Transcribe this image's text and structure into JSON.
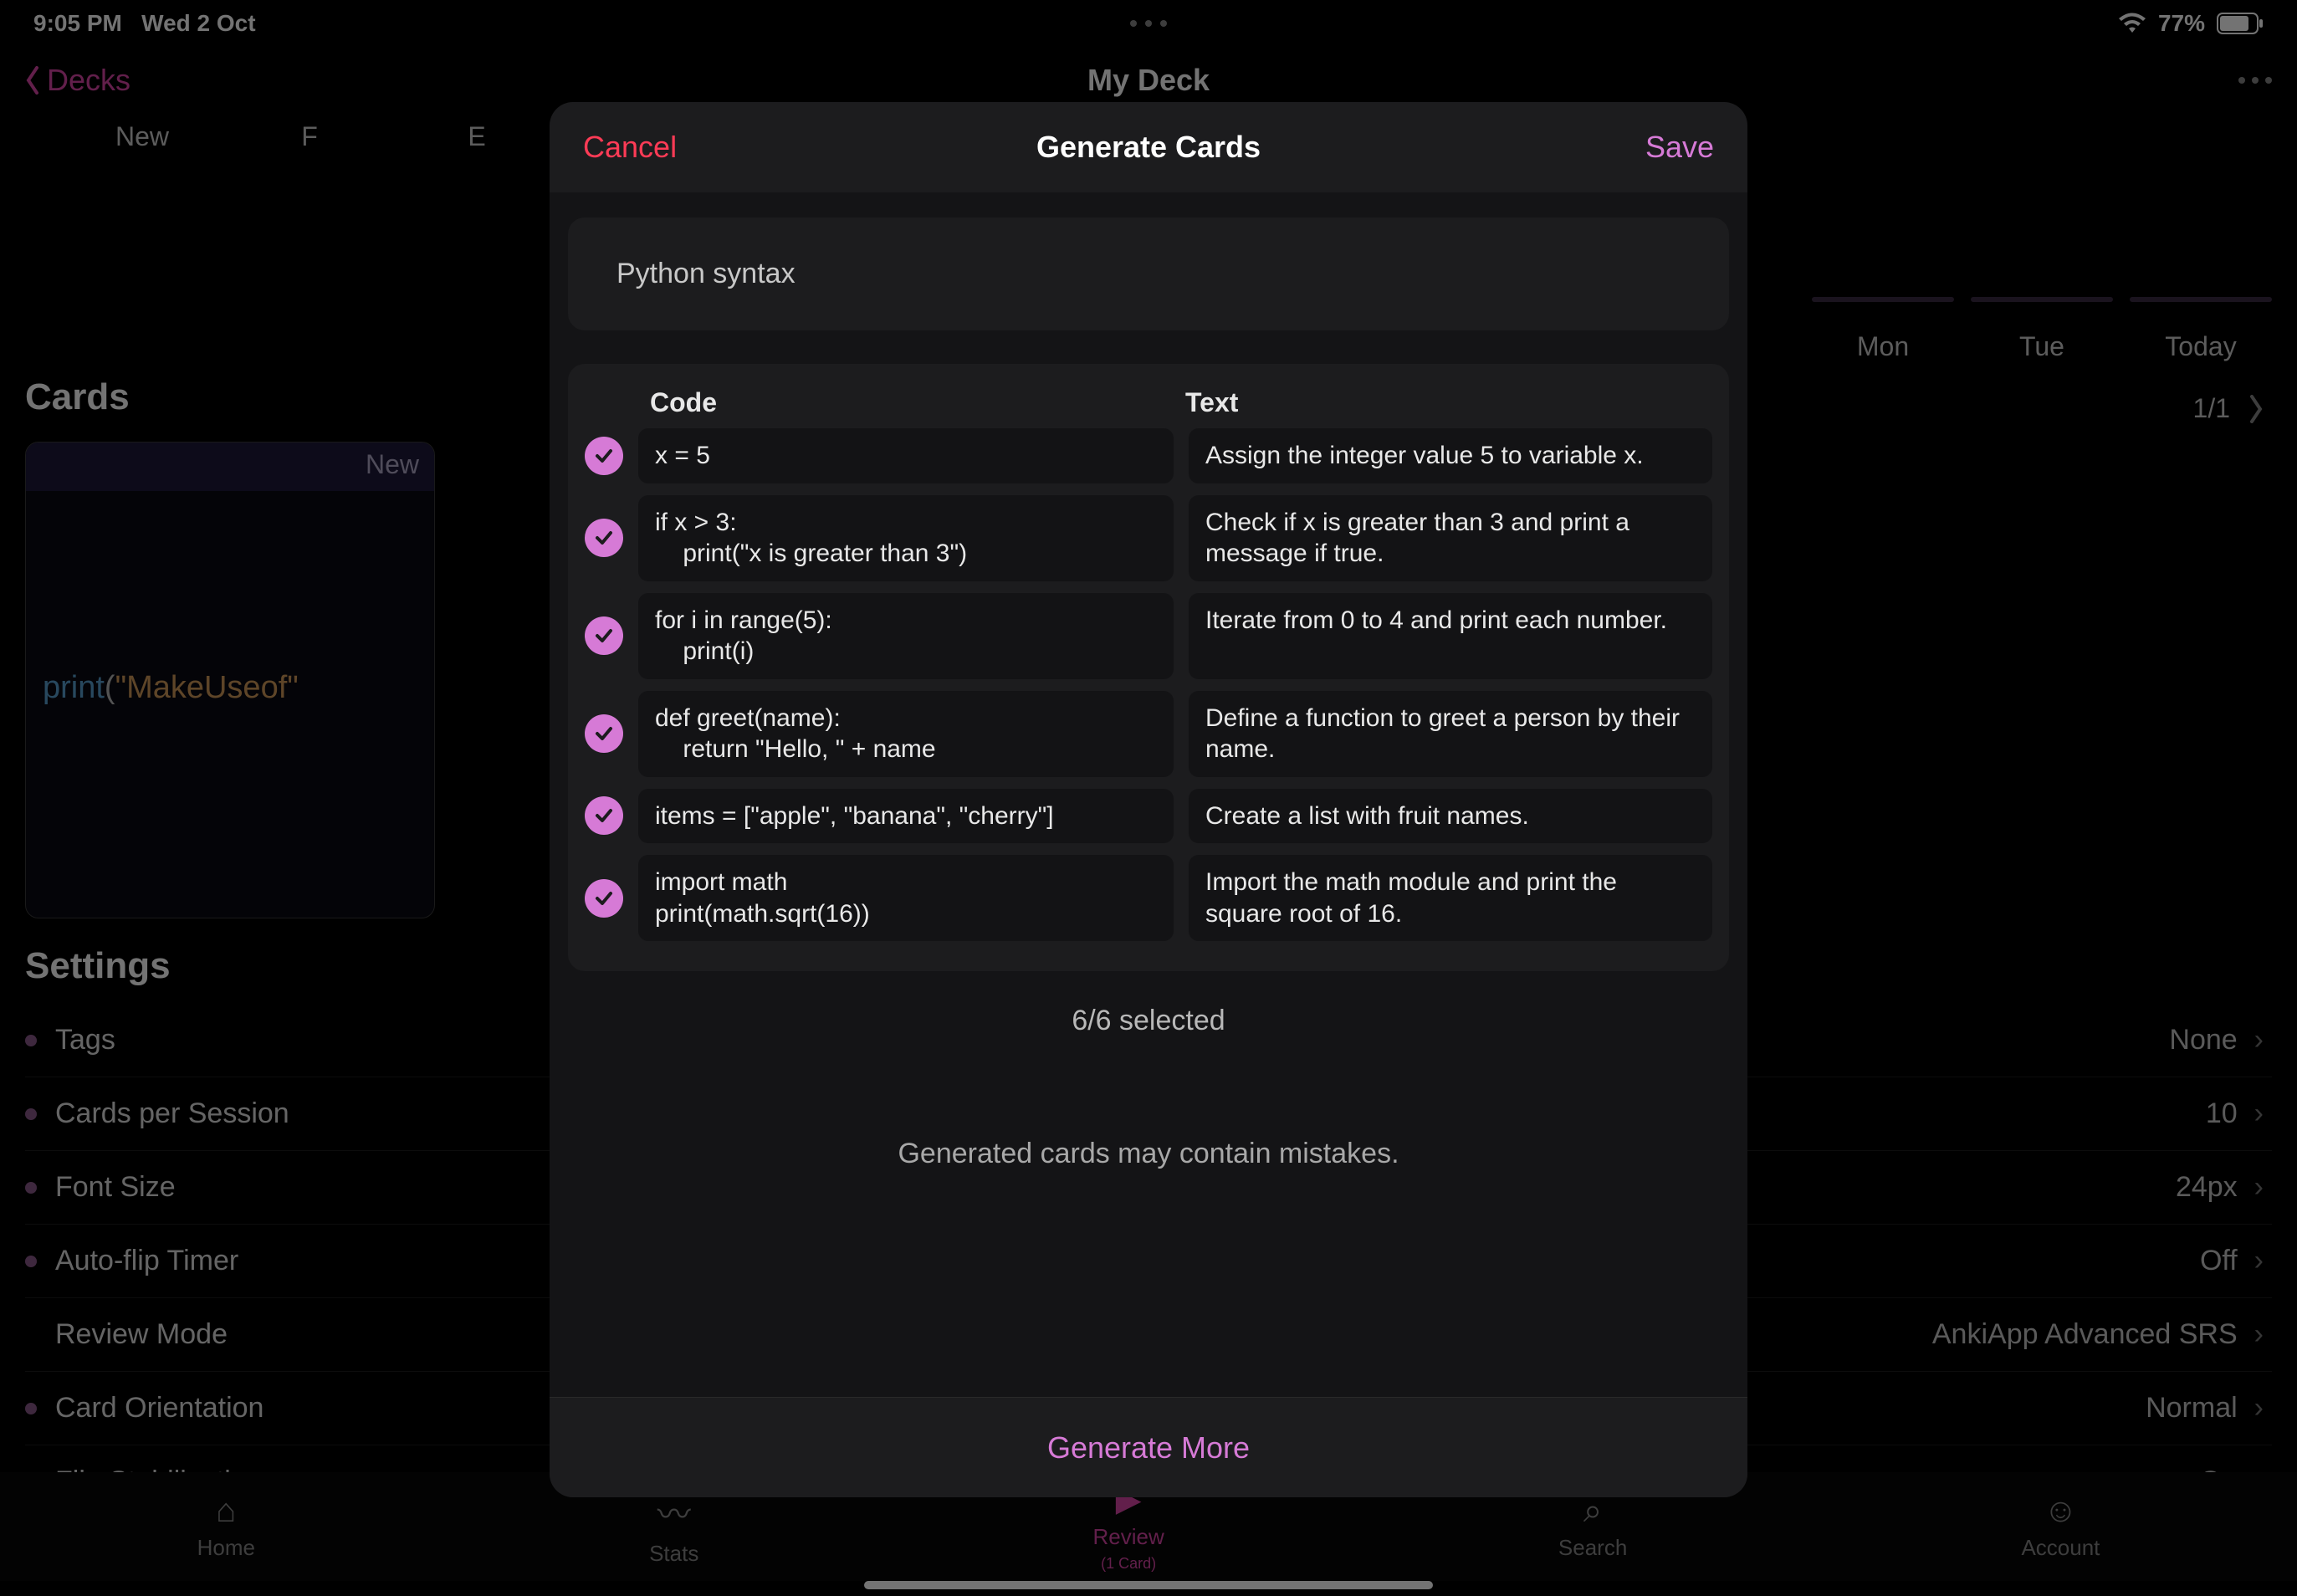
{
  "status": {
    "time": "9:05 PM",
    "date": "Wed 2 Oct",
    "battery_pct": "77%"
  },
  "header": {
    "back_label": "Decks",
    "title": "My Deck"
  },
  "bg_tabs": {
    "t0": "New",
    "t1": "F",
    "t2": "E"
  },
  "days": {
    "d0": "Mon",
    "d1": "Tue",
    "d2": "Today"
  },
  "pagination": "1/1",
  "cards_section": {
    "heading": "Cards",
    "new_badge": "New",
    "code_fn": "print",
    "code_paren_open": "(",
    "code_str": "\"MakeUseof\"",
    "code_paren_close_extra": ""
  },
  "settings": {
    "heading": "Settings",
    "rows": {
      "tags": {
        "label": "Tags",
        "value": "None"
      },
      "cps": {
        "label": "Cards per Session",
        "value": "10"
      },
      "fontsize": {
        "label": "Font Size",
        "value": "24px"
      },
      "autoflip": {
        "label": "Auto-flip Timer",
        "value": "Off"
      },
      "review": {
        "label": "Review Mode",
        "value": "AnkiApp Advanced SRS"
      },
      "orient": {
        "label": "Card Orientation",
        "value": "Normal"
      },
      "flipstab": {
        "label": "Flip Stabilization",
        "value": "On"
      }
    }
  },
  "tabbar": {
    "home": "Home",
    "stats": "Stats",
    "review": "Review",
    "review_sub": "(1 Card)",
    "search": "Search",
    "account": "Account"
  },
  "modal": {
    "cancel": "Cancel",
    "title": "Generate Cards",
    "save": "Save",
    "topic": "Python syntax",
    "col_code": "Code",
    "col_text": "Text",
    "rows": [
      {
        "code": "x = 5",
        "text": "Assign the integer value 5 to variable x."
      },
      {
        "code": "if x > 3:\n    print(\"x is greater than 3\")",
        "text": "Check if x is greater than 3 and print a message if true."
      },
      {
        "code": "for i in range(5):\n    print(i)",
        "text": "Iterate from 0 to 4 and print each number."
      },
      {
        "code": "def greet(name):\n    return \"Hello, \" + name",
        "text": "Define a function to greet a person by their name."
      },
      {
        "code": "items = [\"apple\", \"banana\", \"cherry\"]",
        "text": "Create a list with fruit names."
      },
      {
        "code": "import math\nprint(math.sqrt(16))",
        "text": "Import the math module and print the square root of 16."
      }
    ],
    "selected": "6/6 selected",
    "disclaimer": "Generated cards may contain mistakes.",
    "generate_more": "Generate More"
  }
}
